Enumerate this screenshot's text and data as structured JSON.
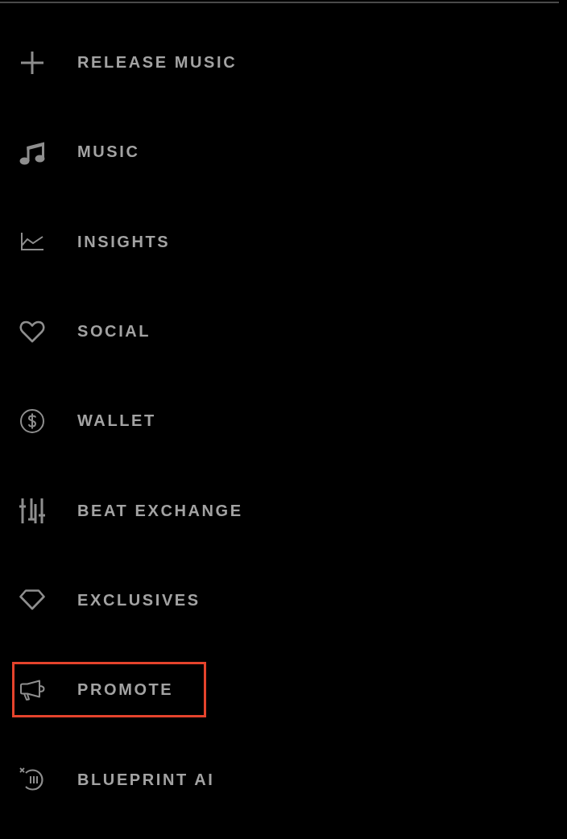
{
  "menu": {
    "items": [
      {
        "label": "RELEASE MUSIC",
        "highlighted": false
      },
      {
        "label": "MUSIC",
        "highlighted": false
      },
      {
        "label": "INSIGHTS",
        "highlighted": false
      },
      {
        "label": "SOCIAL",
        "highlighted": false
      },
      {
        "label": "WALLET",
        "highlighted": false
      },
      {
        "label": "BEAT EXCHANGE",
        "highlighted": false
      },
      {
        "label": "EXCLUSIVES",
        "highlighted": false
      },
      {
        "label": "PROMOTE",
        "highlighted": true
      },
      {
        "label": "BLUEPRINT AI",
        "highlighted": false
      }
    ]
  }
}
